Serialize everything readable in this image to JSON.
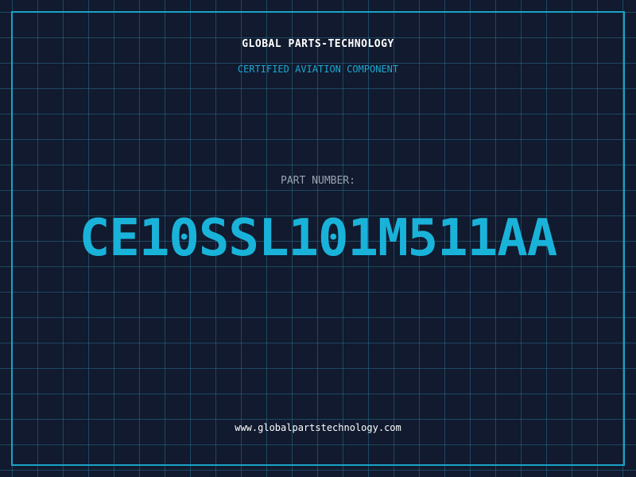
{
  "header": {
    "company_name": "GLOBAL PARTS-TECHNOLOGY",
    "tagline": "CERTIFIED AVIATION COMPONENT"
  },
  "part": {
    "label": "PART NUMBER:",
    "number": "CE10SSL101M511AA"
  },
  "footer": {
    "website": "www.globalpartstechnology.com"
  },
  "colors": {
    "background": "#111a2e",
    "grid": "#286e8c",
    "frame": "#1aa3c6",
    "accent": "#19b3da",
    "label": "#9aa3b2",
    "text": "#ffffff"
  }
}
